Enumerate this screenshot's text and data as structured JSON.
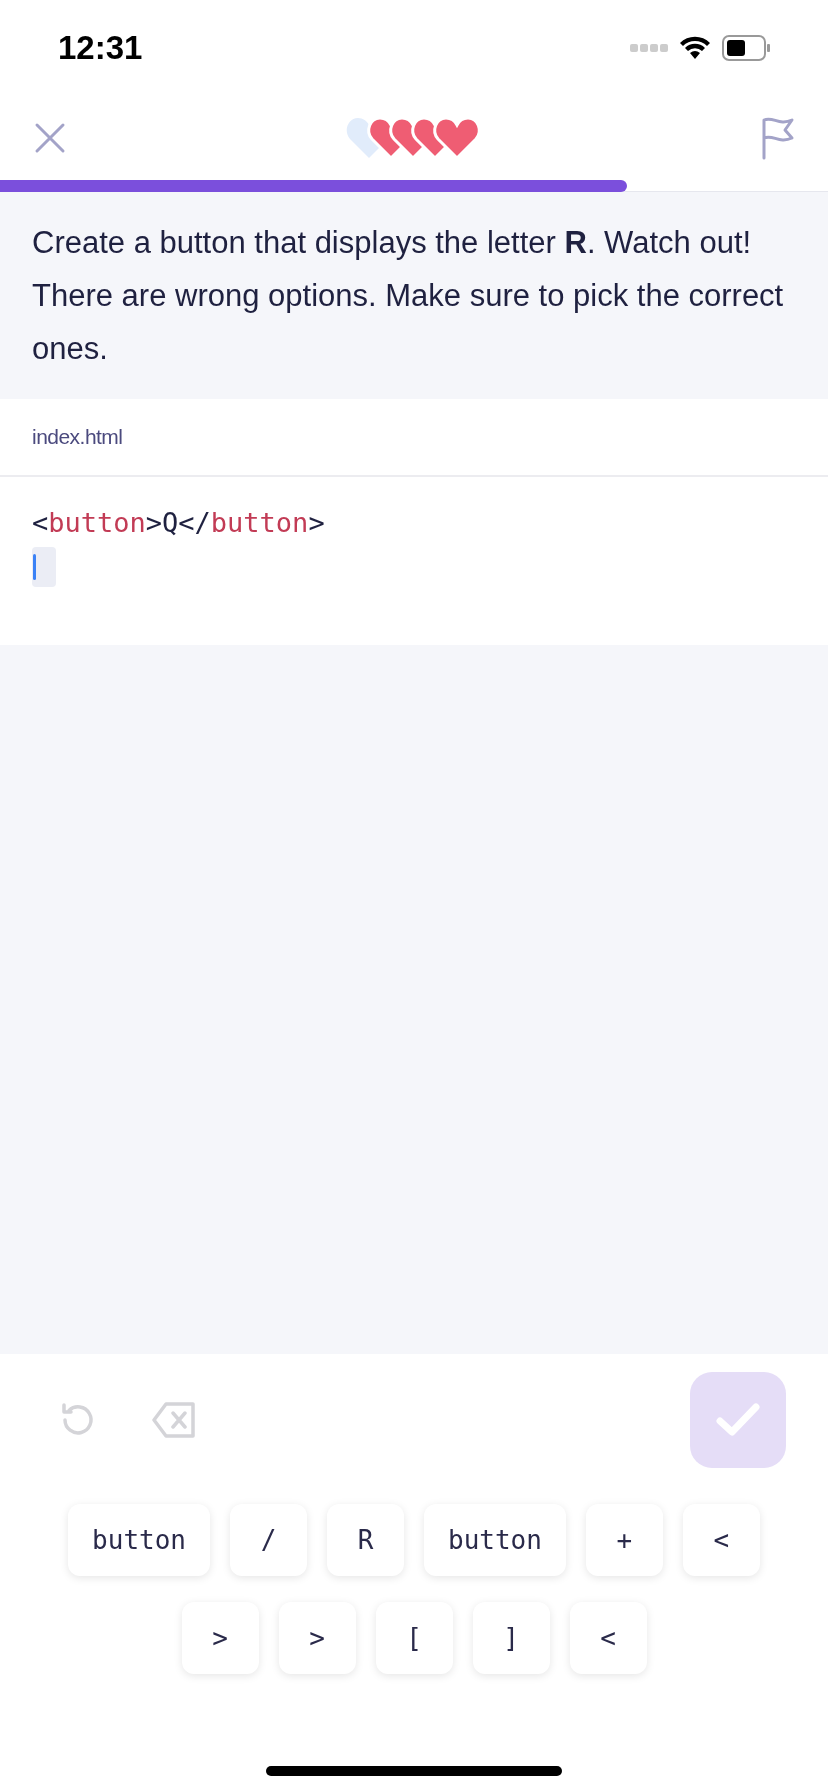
{
  "status_bar": {
    "time": "12:31"
  },
  "header": {
    "hearts": [
      {
        "filled": false
      },
      {
        "filled": true
      },
      {
        "filled": true
      },
      {
        "filled": true
      },
      {
        "filled": true
      }
    ],
    "progress": {
      "level": 0.757
    }
  },
  "instruction": "Create a button that displays the letter **R**. Watch out! There are wrong options. Make sure to pick the correct ones.",
  "file_tab": "index.html",
  "code": {
    "lines": [
      [
        {
          "kind": "punct",
          "text": "<"
        },
        {
          "kind": "tag",
          "text": "button"
        },
        {
          "kind": "punct",
          "text": ">Q</"
        },
        {
          "kind": "tag",
          "text": "button"
        },
        {
          "kind": "punct",
          "text": ">"
        }
      ]
    ],
    "cursor_line": true
  },
  "toolbar": {
    "check_disabled": true
  },
  "keys": [
    [
      "button",
      "/",
      "R",
      "button",
      "+",
      "<"
    ],
    [
      ">",
      ">",
      "[",
      "]",
      "<"
    ]
  ]
}
